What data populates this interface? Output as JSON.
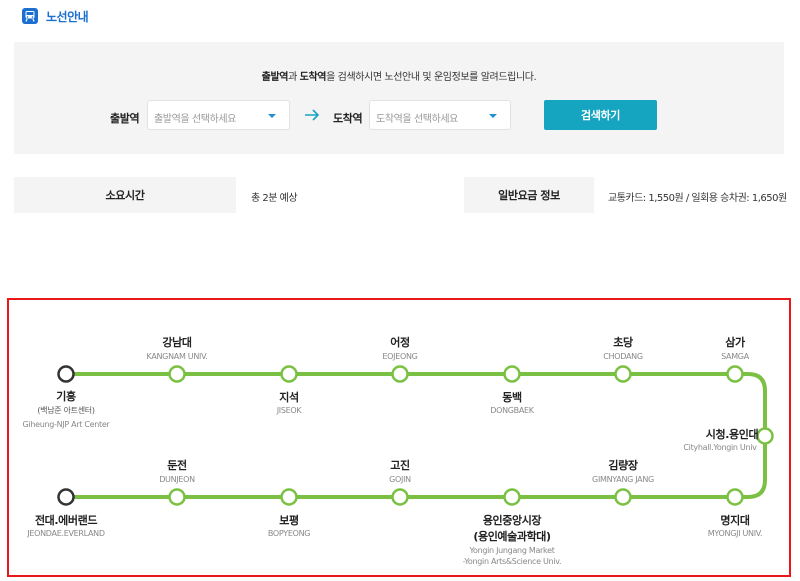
{
  "header": {
    "title": "노선안내",
    "icon": "train-icon",
    "accent_color": "#1a6fd0"
  },
  "search": {
    "intro_departure": "출발역",
    "intro_and": "과 ",
    "intro_arrival": "도착역",
    "intro_rest": "을 검색하시면 노선안내 및 운임정보를 알려드립니다.",
    "departure_label": "출발역",
    "departure_placeholder": "출발역을 선택하세요",
    "arrival_label": "도착역",
    "arrival_placeholder": "도착역을 선택하세요",
    "button_label": "검색하기",
    "button_color": "#16a5c0"
  },
  "info": {
    "time_label": "소요시간",
    "time_value": "총 2분 예상",
    "fare_label": "일반요금 정보",
    "fare_value": "교통카드: 1,550원 / 일회용 승차권: 1,650원"
  },
  "route": {
    "line_color": "#7ac143",
    "stations": [
      {
        "id": "giheung",
        "name": "기흥",
        "sub": "(백남준 아트센터)",
        "eng": "Giheung-NJP Art Center",
        "terminal": true
      },
      {
        "id": "kangnam",
        "name": "강남대",
        "eng": "KANGNAM UNIV."
      },
      {
        "id": "jiseok",
        "name": "지석",
        "eng": "JISEOK"
      },
      {
        "id": "eojeong",
        "name": "어정",
        "eng": "EOJEONG"
      },
      {
        "id": "dongbaek",
        "name": "동백",
        "eng": "DONGBAEK"
      },
      {
        "id": "chodang",
        "name": "초당",
        "eng": "CHODANG"
      },
      {
        "id": "samga",
        "name": "삼가",
        "eng": "SAMGA"
      },
      {
        "id": "cityhall",
        "name": "시청.용인대",
        "eng": "Cityhall.Yongin Univ"
      },
      {
        "id": "myongji",
        "name": "명지대",
        "eng": "MYONGJI UNIV."
      },
      {
        "id": "gimnyang",
        "name": "김량장",
        "eng": "GIMNYANG JANG"
      },
      {
        "id": "yongin_jungang",
        "name": "용인중앙시장",
        "name2": "(용인예술과학대)",
        "eng": "Yongin Jungang Market",
        "eng2": "-Yongin Arts&Science Univ."
      },
      {
        "id": "gojin",
        "name": "고진",
        "eng": "GOJIN"
      },
      {
        "id": "bopyeong",
        "name": "보평",
        "eng": "BOPYEONG"
      },
      {
        "id": "dunjeon",
        "name": "둔전",
        "eng": "DUNJEON"
      },
      {
        "id": "jeondae",
        "name": "전대.에버랜드",
        "eng": "JEONDAE.EVERLAND",
        "terminal": true
      }
    ]
  }
}
